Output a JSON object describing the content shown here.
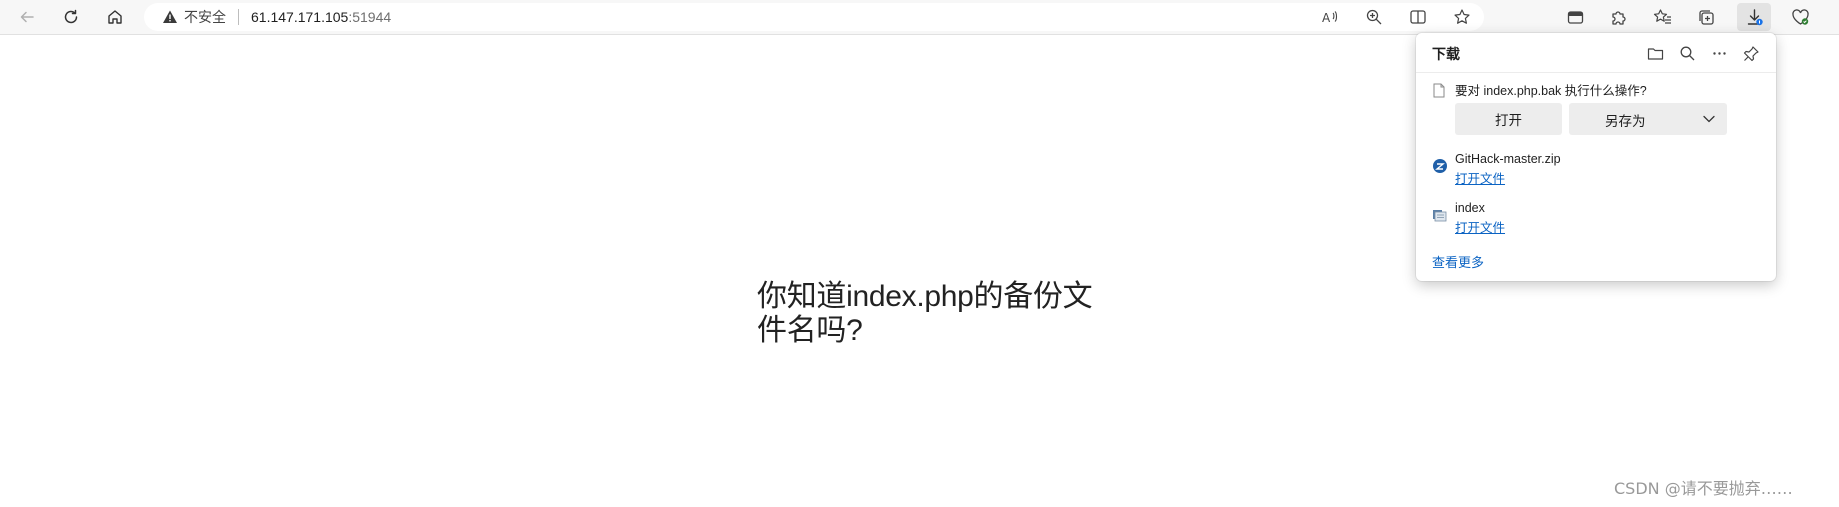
{
  "browser": {
    "address": {
      "security_label": "不安全",
      "host": "61.147.171.105",
      "port": ":51944"
    }
  },
  "page": {
    "main_text": "你知道index.php的备份文件名吗?"
  },
  "downloads_panel": {
    "title": "下载",
    "pending": {
      "prompt": "要对 index.php.bak 执行什么操作?",
      "open_label": "打开",
      "save_as_label": "另存为"
    },
    "items": [
      {
        "name": "GitHack-master.zip",
        "action": "打开文件",
        "icon": "zip-file-icon"
      },
      {
        "name": "index",
        "action": "打开文件",
        "icon": "generic-file-icon"
      }
    ],
    "see_more_label": "查看更多"
  },
  "watermark": "CSDN @请不要抛弃……",
  "colors": {
    "link": "#0b63c3",
    "toolbar_bg": "#f7f7f7",
    "download_badge": "#1a73e8"
  }
}
